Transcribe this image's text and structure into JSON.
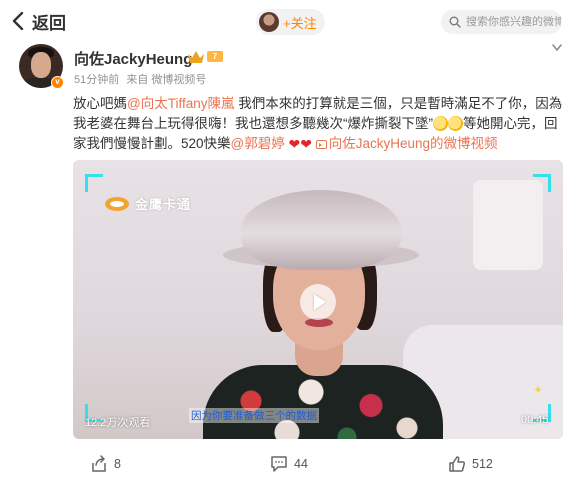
{
  "topbar": {
    "back_label": "返回",
    "follow_label": "+关注",
    "search_placeholder": "搜索你感兴趣的微博"
  },
  "author": {
    "name": "向佐JackyHeung",
    "level": "7",
    "time": "51分钟前",
    "source": "来自 微博视频号"
  },
  "post": {
    "p1": "放心吧媽",
    "mention1": "@向太Tiffany陳嵐",
    "p2": " 我們本來的打算就是三個，只是暫時滿足不了你，因為我老婆在舞台上玩得很嗨！我也還想多聽幾次“爆炸撕裂下墜”",
    "p3": "等她開心完，回家我們慢慢計劃。520快樂",
    "mention2": "@郭碧婷",
    "video_link": "向佐JackyHeung的微博视频"
  },
  "video": {
    "logo_text": "金鹰卡通",
    "caption": "因为你要准备做三个的数据",
    "views": "12.2万次观看",
    "duration": "00:45"
  },
  "actions": {
    "share_count": "8",
    "comment_count": "44",
    "like_count": "512"
  },
  "colors": {
    "accent": "#ff8200",
    "link": "#eb7350",
    "frame": "#34e0e9"
  }
}
